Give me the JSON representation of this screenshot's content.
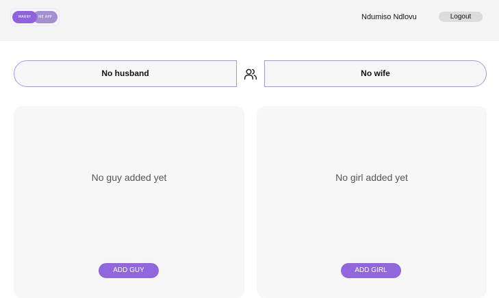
{
  "header": {
    "logo": {
      "left_text": "MARRY",
      "right_text": "ME APP"
    },
    "username": "Ndumiso Ndlovu",
    "logout_label": "Logout"
  },
  "couple": {
    "husband_label": "No husband",
    "wife_label": "No wife",
    "icon": "users-icon"
  },
  "panels": {
    "guys": {
      "empty_text": "No guy added yet",
      "add_label": "ADD GUY"
    },
    "girls": {
      "empty_text": "No girl added yet",
      "add_label": "ADD GIRL"
    }
  },
  "colors": {
    "accent": "#9067dd",
    "border": "#a896df",
    "header_bg": "#f5f5f5",
    "panel_bg": "#f7f7f7"
  }
}
